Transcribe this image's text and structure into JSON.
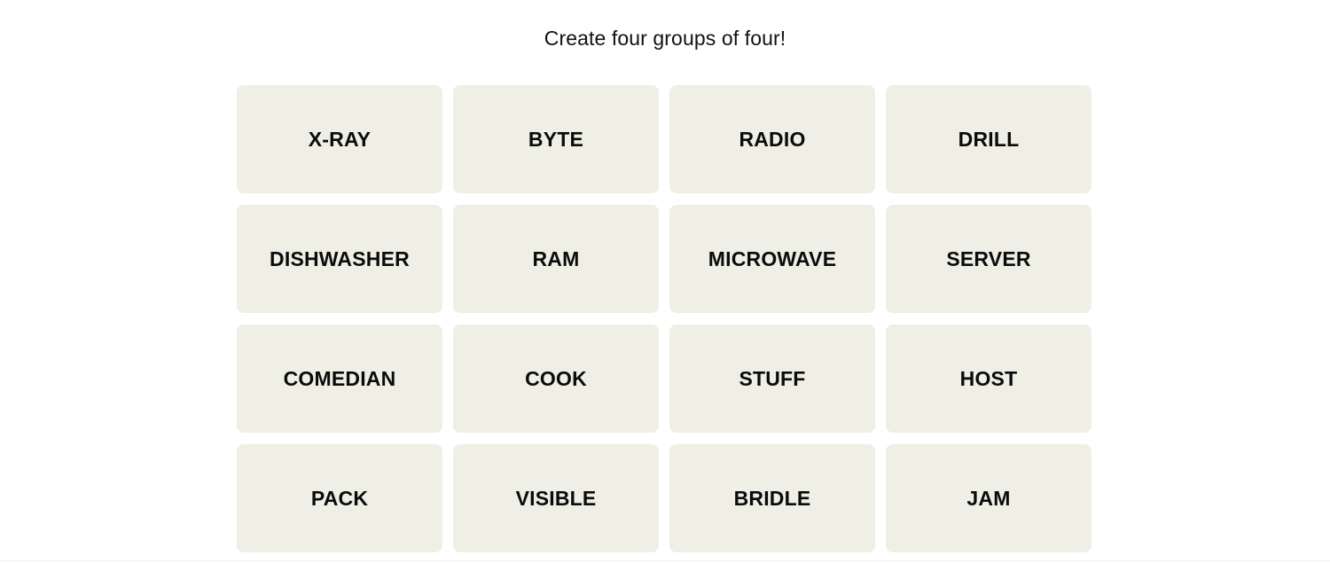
{
  "header": {
    "instruction": "Create four groups of four!"
  },
  "grid": {
    "columns": 4,
    "rows": 4,
    "tile_color": "#EFEFE6",
    "page_background": "#FFFFFF",
    "text_color": "#0B0B0B",
    "tiles": [
      {
        "label": "X-RAY"
      },
      {
        "label": "BYTE"
      },
      {
        "label": "RADIO"
      },
      {
        "label": "DRILL"
      },
      {
        "label": "DISHWASHER"
      },
      {
        "label": "RAM"
      },
      {
        "label": "MICROWAVE"
      },
      {
        "label": "SERVER"
      },
      {
        "label": "COMEDIAN"
      },
      {
        "label": "COOK"
      },
      {
        "label": "STUFF"
      },
      {
        "label": "HOST"
      },
      {
        "label": "PACK"
      },
      {
        "label": "VISIBLE"
      },
      {
        "label": "BRIDLE"
      },
      {
        "label": "JAM"
      }
    ]
  }
}
